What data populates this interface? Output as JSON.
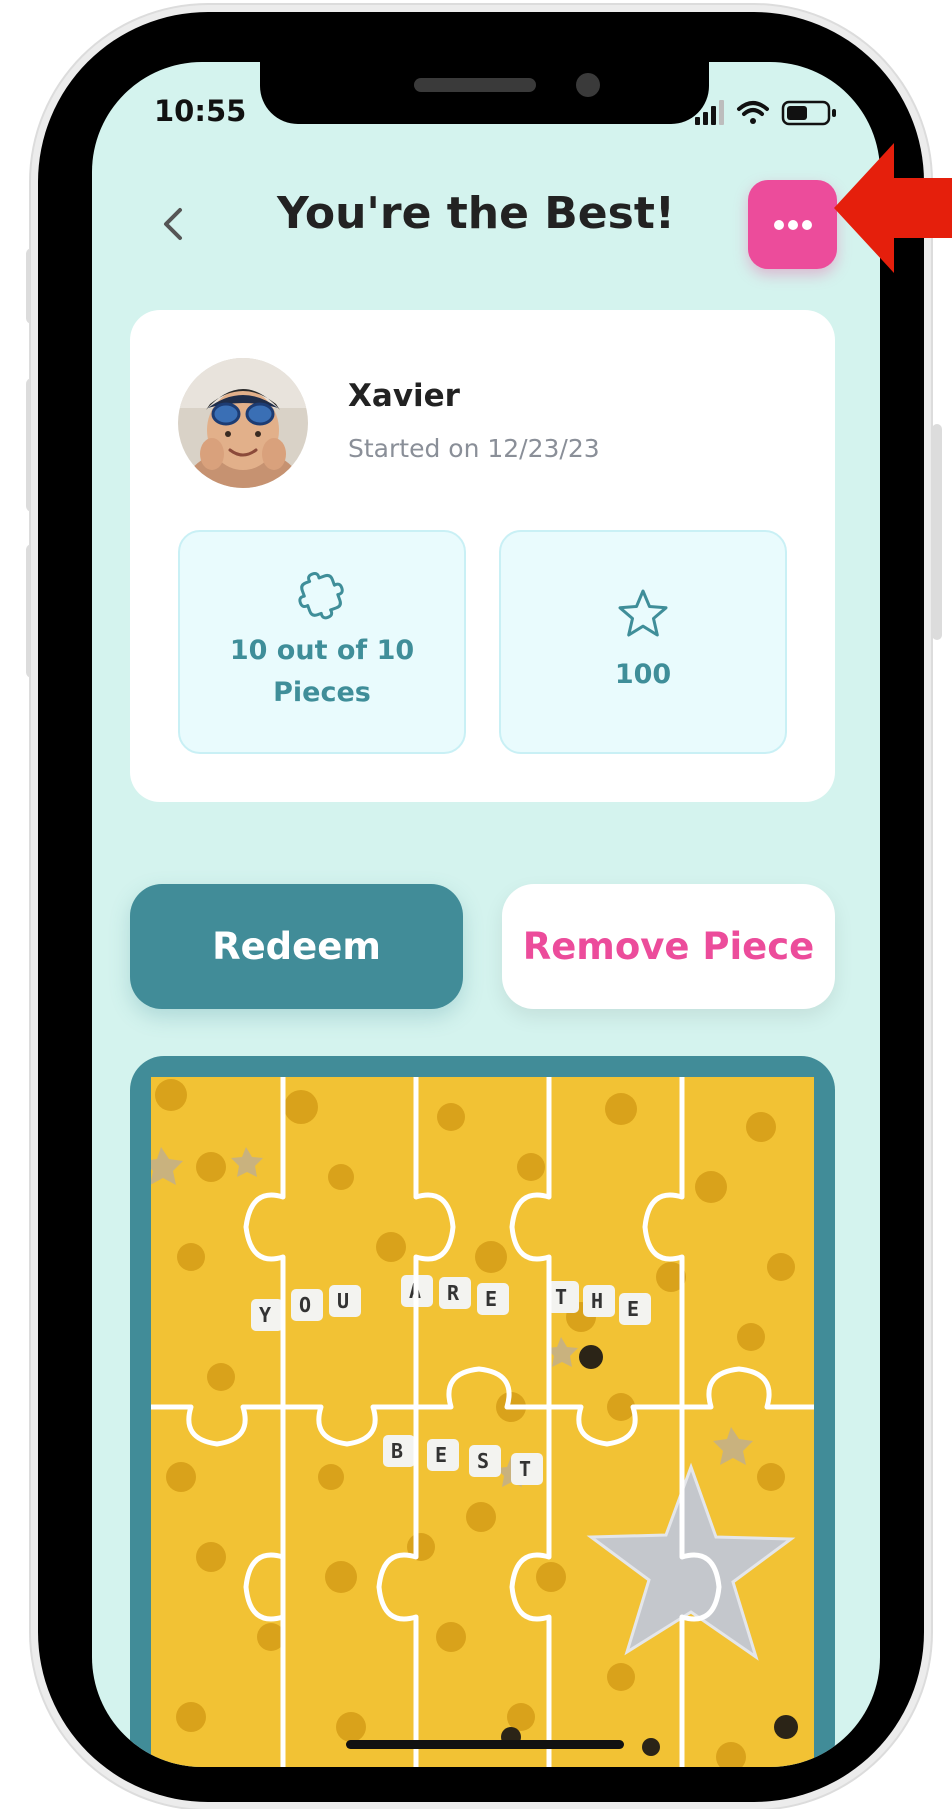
{
  "status_bar": {
    "time": "10:55"
  },
  "header": {
    "title": "You're the Best!"
  },
  "profile": {
    "name": "Xavier",
    "started": "Started on 12/23/23"
  },
  "stats": {
    "pieces_label": "10 out of 10 Pieces",
    "points": "100"
  },
  "actions": {
    "redeem_label": "Redeem",
    "remove_label": "Remove Piece"
  },
  "puzzle_words": {
    "line1": [
      "Y",
      "O",
      "U",
      "A",
      "R",
      "E",
      "T",
      "H",
      "E"
    ],
    "line2": [
      "B",
      "E",
      "S",
      "T"
    ]
  },
  "icons": {
    "back": "chevron-left-icon",
    "more": "more-horizontal-icon",
    "pieces": "puzzle-piece-icon",
    "points": "star-icon"
  },
  "colors": {
    "accent_pink": "#ec4c9b",
    "teal": "#418c98",
    "background": "#d4f3ee",
    "annotation_arrow": "#e51f0c"
  }
}
